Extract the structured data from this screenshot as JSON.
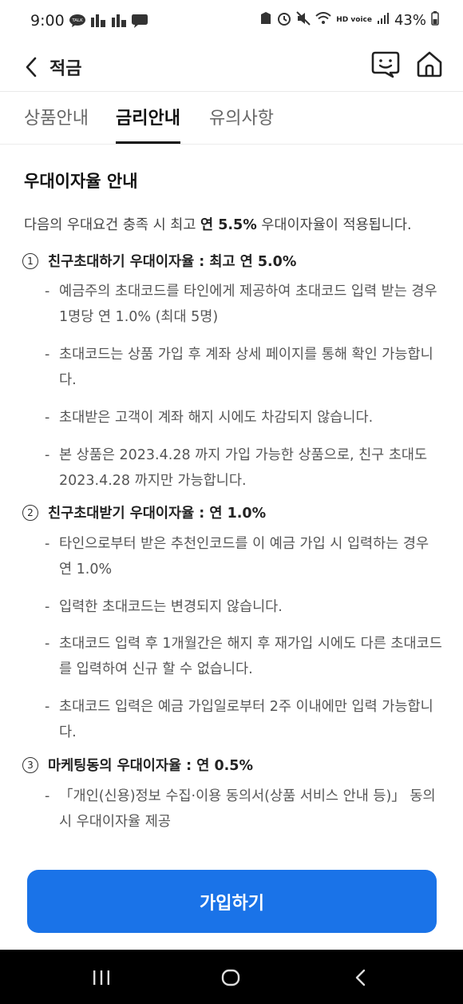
{
  "status_bar": {
    "time": "9:00",
    "battery": "43%",
    "network_badge": "HD voice"
  },
  "header": {
    "title": "적금",
    "icons": [
      "chevron-left-icon",
      "chat-smile-icon",
      "home-icon"
    ]
  },
  "tabs": [
    {
      "label": "상품안내",
      "active": false
    },
    {
      "label": "금리안내",
      "active": true
    },
    {
      "label": "유의사항",
      "active": false
    }
  ],
  "section": {
    "title": "우대이자율 안내",
    "intro_prefix": "다음의 우대요건 충족 시 최고 ",
    "intro_bold": "연 5.5%",
    "intro_suffix": " 우대이자율이 적용됩니다."
  },
  "conditions": [
    {
      "number": "1",
      "title": "친구초대하기 우대이자율 : 최고 연 5.0%",
      "bullets": [
        "예금주의 초대코드를 타인에게 제공하여 초대코드 입력 받는 경우 1명당 연 1.0% (최대 5명)",
        "초대코드는 상품 가입 후 계좌 상세 페이지를 통해 확인 가능합니다.",
        "초대받은 고객이 계좌 해지 시에도 차감되지 않습니다.",
        "본 상품은 2023.4.28 까지 가입 가능한 상품으로, 친구 초대도 2023.4.28 까지만 가능합니다."
      ]
    },
    {
      "number": "2",
      "title": "친구초대받기 우대이자율 : 연 1.0%",
      "bullets": [
        "타인으로부터 받은 추천인코드를 이 예금 가입 시 입력하는 경우 연 1.0%",
        "입력한 초대코드는 변경되지 않습니다.",
        "초대코드 입력 후 1개월간은 해지 후 재가입 시에도 다른 초대코드를 입력하여 신규 할 수 없습니다.",
        "초대코드 입력은 예금 가입일로부터 2주 이내에만 입력 가능합니다."
      ]
    },
    {
      "number": "3",
      "title": "마케팅동의 우대이자율 : 연 0.5%",
      "bullets": [
        "「개인(신용)정보 수집·이용 동의서(상품 서비스 안내 등)」 동의 시 우대이자율 제공"
      ]
    }
  ],
  "cta": {
    "label": "가입하기",
    "color": "#1a73e8"
  },
  "nav_bar": {
    "icons": [
      "recent-apps-icon",
      "home-circle-icon",
      "back-icon"
    ]
  }
}
